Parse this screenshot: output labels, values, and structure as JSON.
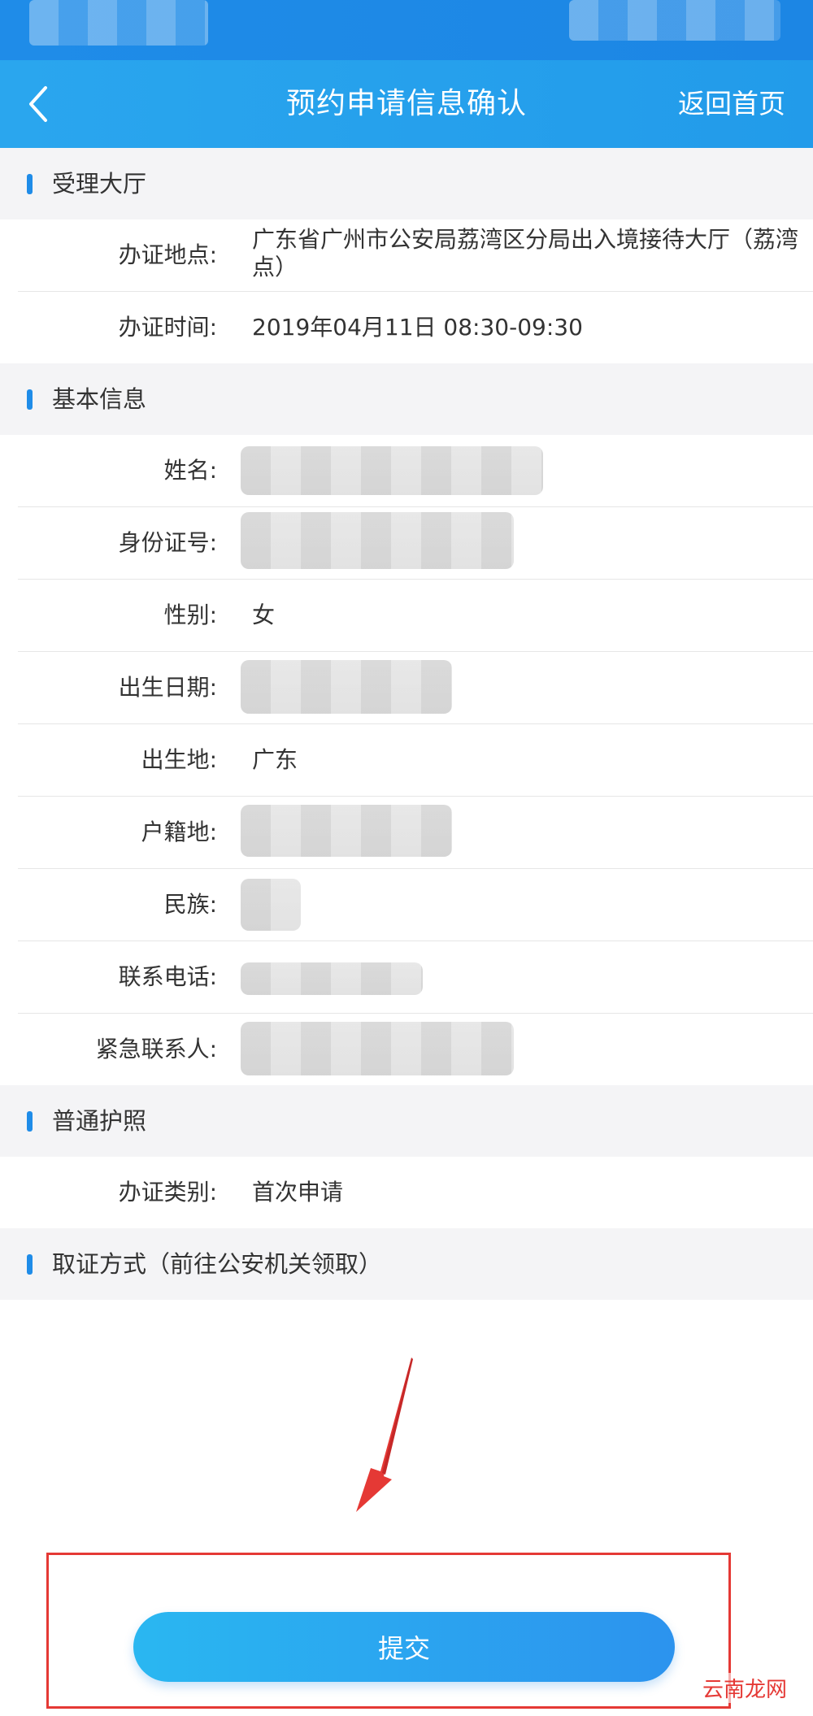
{
  "nav": {
    "title": "预约申请信息确认",
    "home_label": "返回首页"
  },
  "sections": {
    "hall": "受理大厅",
    "basic": "基本信息",
    "passport": "普通护照",
    "pickup": "取证方式（前往公安机关领取）"
  },
  "hall": {
    "location_label": "办证地点:",
    "location_value": "广东省广州市公安局荔湾区分局出入境接待大厅（荔湾点）",
    "time_label": "办证时间:",
    "time_value": "2019年04月11日   08:30-09:30"
  },
  "basic": {
    "name_label": "姓名:",
    "id_label": "身份证号:",
    "gender_label": "性别:",
    "gender_value": "女",
    "birthdate_label": "出生日期:",
    "birthplace_label": "出生地:",
    "birthplace_value": "广东",
    "household_label": "户籍地:",
    "ethnicity_label": "民族:",
    "phone_label": "联系电话:",
    "emergency_label": "紧急联系人:"
  },
  "passport": {
    "type_label": "办证类别:",
    "type_value": "首次申请"
  },
  "submit_label": "提交",
  "watermark": "云南龙网",
  "colors": {
    "nav": "#229bea",
    "accent": "#1f8ce8",
    "highlight": "#e53935"
  }
}
